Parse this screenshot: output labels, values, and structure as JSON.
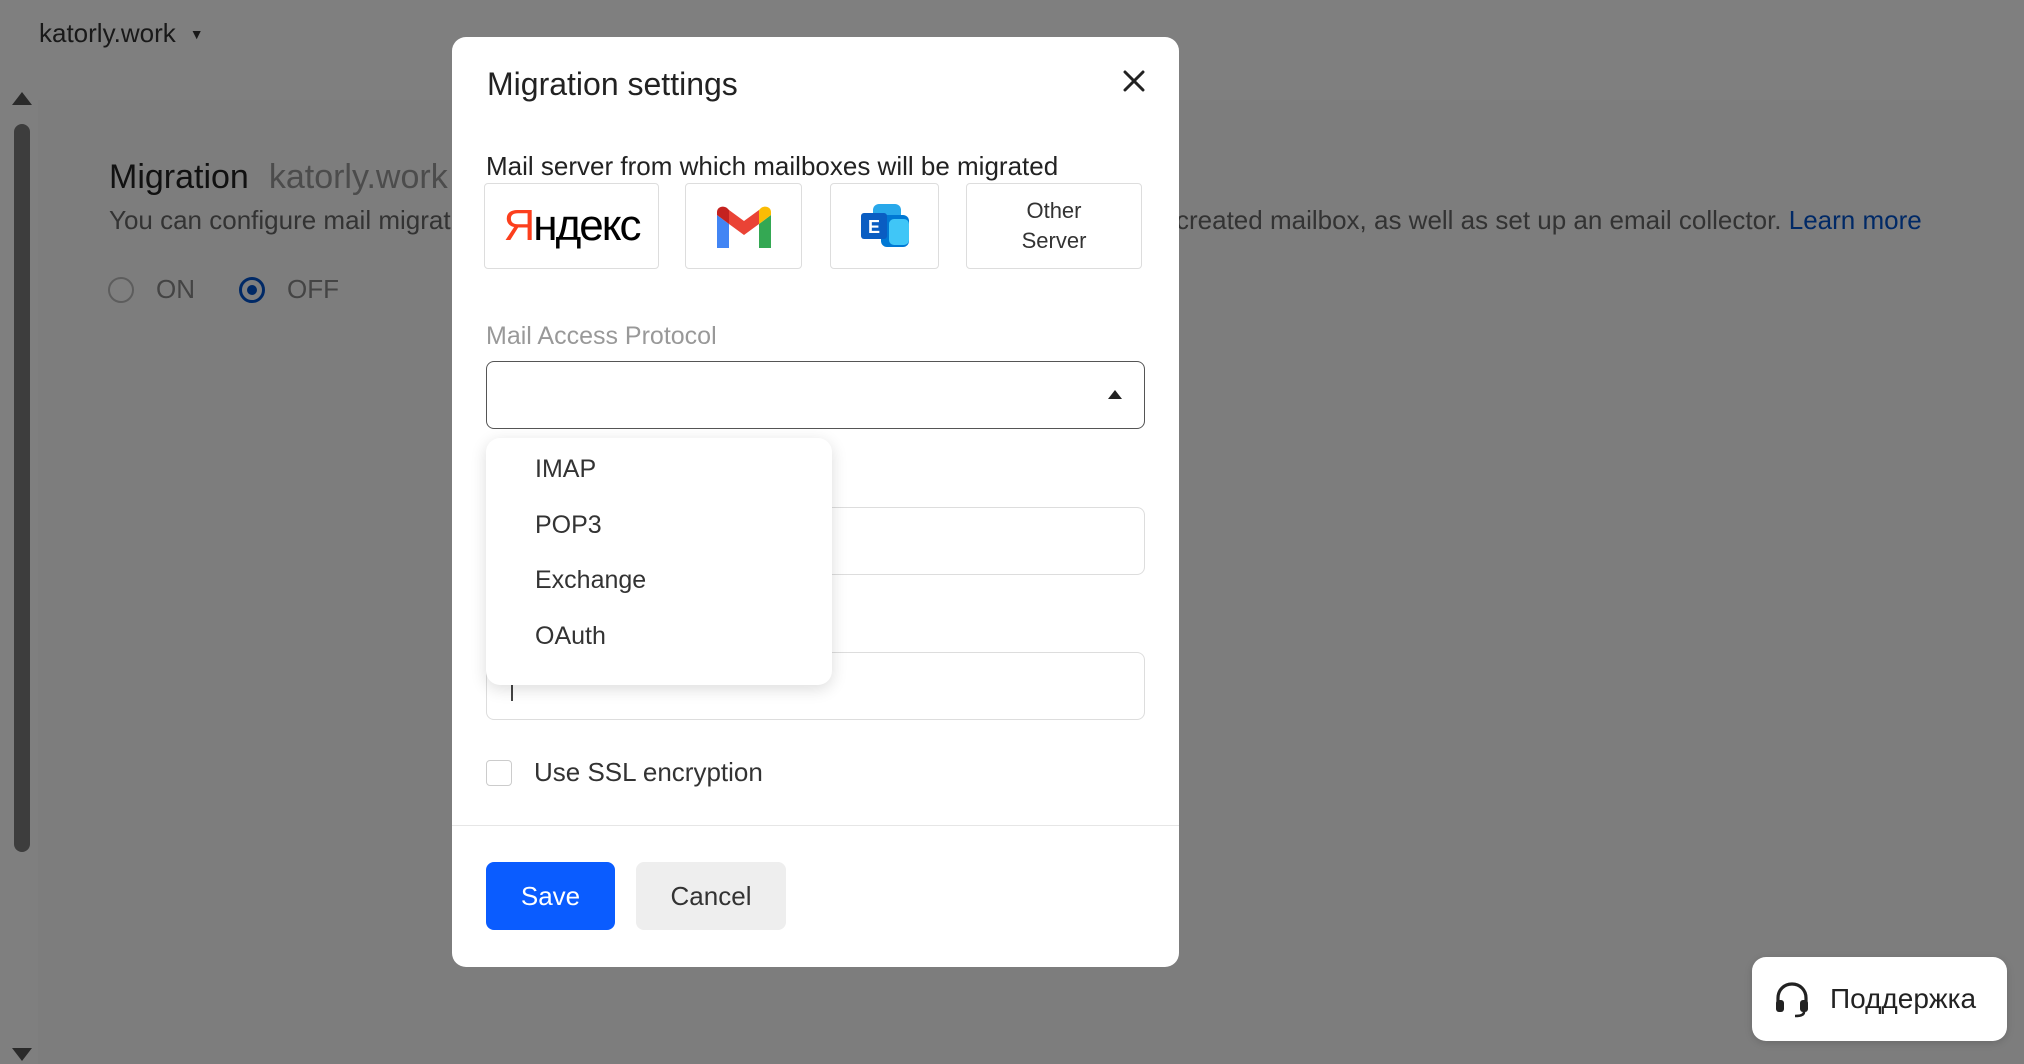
{
  "header": {
    "domain": "katorly.work"
  },
  "page": {
    "title": "Migration",
    "domain": "katorly.work",
    "description_left": "You can configure mail migrati",
    "description_right": "created mailbox, as well as set up an email collector.",
    "learn_more": "Learn more",
    "toggle": {
      "on_label": "ON",
      "off_label": "OFF",
      "selected": "OFF"
    }
  },
  "modal": {
    "title": "Migration settings",
    "server_label": "Mail server from which mailboxes will be migrated",
    "servers": [
      {
        "name": "Яндекс",
        "icon": "yandex-logo"
      },
      {
        "name": "Gmail",
        "icon": "gmail-logo"
      },
      {
        "name": "Exchange",
        "icon": "exchange-logo"
      },
      {
        "name": "Other Server",
        "line1": "Other",
        "line2": "Server"
      }
    ],
    "protocol_label": "Mail Access Protocol",
    "protocol_value": "",
    "protocol_options": [
      "IMAP",
      "POP3",
      "Exchange",
      "OAuth"
    ],
    "ssl_label": "Use SSL encryption",
    "ssl_checked": false,
    "save_label": "Save",
    "cancel_label": "Cancel"
  },
  "support": {
    "label": "Поддержка",
    "icon": "headset-icon"
  },
  "colors": {
    "primary": "#0a5cff",
    "link": "#0052cc",
    "yandex_red": "#fc3f1d"
  }
}
